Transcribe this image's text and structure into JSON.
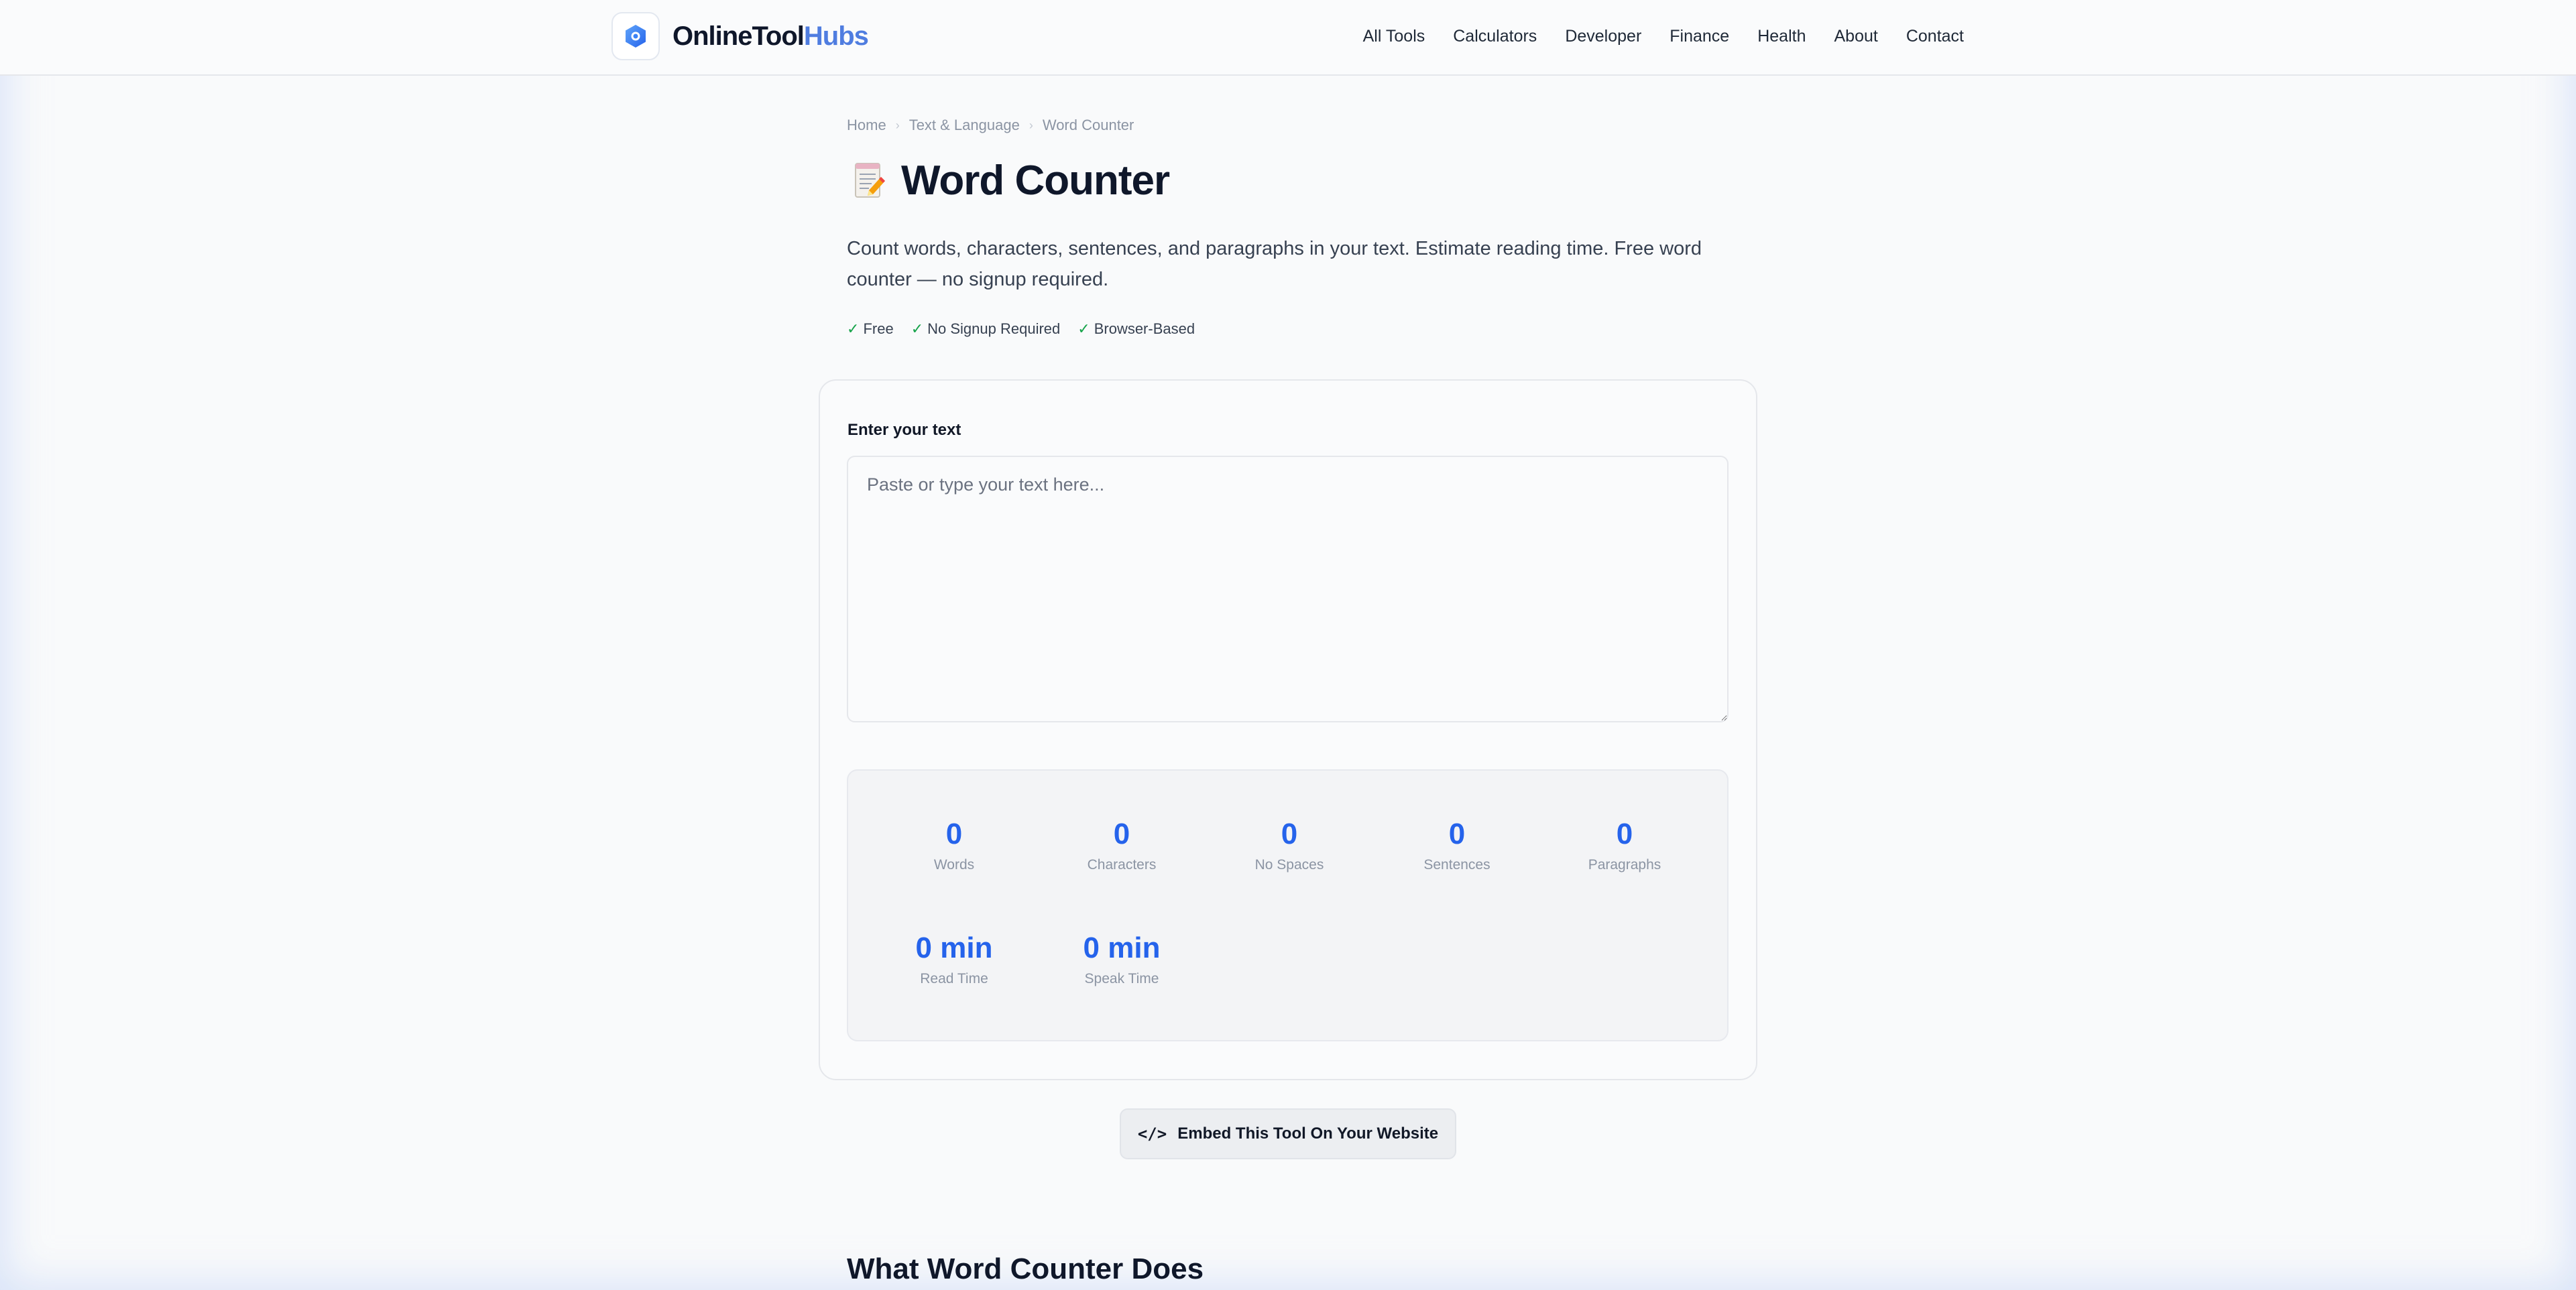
{
  "brand": {
    "name_dark": "OnlineTool",
    "name_accent": "Hubs",
    "accent_color": "#4f7de0"
  },
  "nav": [
    "All Tools",
    "Calculators",
    "Developer",
    "Finance",
    "Health",
    "About",
    "Contact"
  ],
  "breadcrumb": [
    "Home",
    "Text & Language",
    "Word Counter"
  ],
  "page": {
    "icon": "memo-icon",
    "title": "Word Counter",
    "description": "Count words, characters, sentences, and paragraphs in your text. Estimate reading time. Free word counter — no signup required.",
    "badges": [
      "Free",
      "No Signup Required",
      "Browser-Based"
    ]
  },
  "tool": {
    "input_label": "Enter your text",
    "input_placeholder": "Paste or type your text here...",
    "input_value": "",
    "stats": [
      {
        "value": "0",
        "label": "Words"
      },
      {
        "value": "0",
        "label": "Characters"
      },
      {
        "value": "0",
        "label": "No Spaces"
      },
      {
        "value": "0",
        "label": "Sentences"
      },
      {
        "value": "0",
        "label": "Paragraphs"
      },
      {
        "value": "0 min",
        "label": "Read Time"
      },
      {
        "value": "0 min",
        "label": "Speak Time"
      }
    ]
  },
  "embed": {
    "code_glyph": "</>",
    "label": "Embed This Tool On Your Website"
  },
  "section": {
    "heading": "What Word Counter Does"
  },
  "colors": {
    "stat_value": "#2563eb",
    "check": "#16a34a"
  }
}
